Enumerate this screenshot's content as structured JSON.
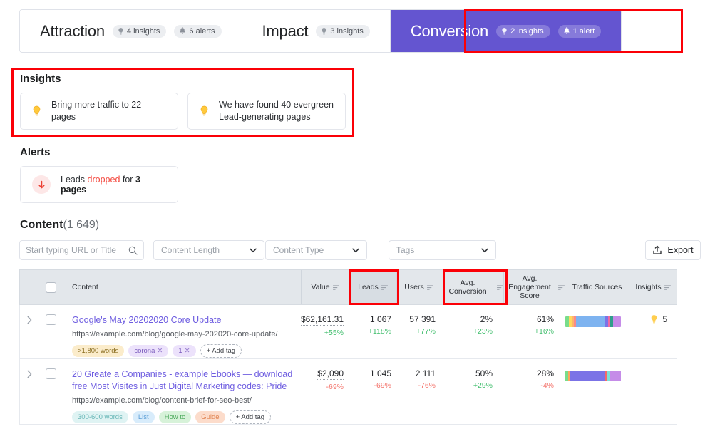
{
  "tabs": [
    {
      "label": "Attraction",
      "badges": [
        {
          "icon": "bulb-icon",
          "text": "4 insights"
        },
        {
          "icon": "bell-icon",
          "text": "6 alerts"
        }
      ],
      "active": false
    },
    {
      "label": "Impact",
      "badges": [
        {
          "icon": "bulb-icon",
          "text": "3 insights"
        }
      ],
      "active": false
    },
    {
      "label": "Conversion",
      "badges": [
        {
          "icon": "bulb-icon",
          "text": "2 insights"
        },
        {
          "icon": "bell-icon",
          "text": "1 alert"
        }
      ],
      "active": true
    }
  ],
  "insights": {
    "title": "Insights",
    "cards": [
      {
        "icon": "bulb-icon",
        "text": "Bring more traffic to 22 pages"
      },
      {
        "icon": "bulb-icon",
        "text": "We have found 40 evergreen Lead-generating pages"
      }
    ]
  },
  "alerts": {
    "title": "Alerts",
    "cards": [
      {
        "icon": "arrow-down-icon",
        "prefix": "Leads ",
        "highlight": "dropped",
        "middle": " for ",
        "strong": "3 pages"
      }
    ]
  },
  "content": {
    "title": "Content",
    "count": "(1 649)"
  },
  "filters": {
    "search_placeholder": "Start typing URL or Title",
    "search_value": "",
    "content_length": "Content Length",
    "content_type": "Content Type",
    "tags": "Tags",
    "export_label": "Export"
  },
  "table": {
    "columns": [
      {
        "label": "Content",
        "sortable": false
      },
      {
        "label": "Value",
        "sortable": true
      },
      {
        "label": "Leads",
        "sortable": true,
        "active": true
      },
      {
        "label": "Users",
        "sortable": true
      },
      {
        "label": "Avg. Conversion",
        "sortable": true
      },
      {
        "label": "Avg. Engagement Score",
        "sortable": true
      },
      {
        "label": "Traffic Sources",
        "sortable": false
      },
      {
        "label": "Insights",
        "sortable": true
      }
    ],
    "rows": [
      {
        "title": "Google's May 20202020 Core Update",
        "url": "https://example.com/blog/google-may-202020-core-update/",
        "tags": [
          {
            "label": ">1,800 words",
            "bg": "#fbeccb",
            "fg": "#8a6d1f",
            "removable": false
          },
          {
            "label": "corona",
            "bg": "#ece2fb",
            "fg": "#7a5bbd",
            "removable": true
          },
          {
            "label": "1",
            "bg": "#ece2fb",
            "fg": "#7a5bbd",
            "removable": true
          }
        ],
        "add_tag_label": "+ Add tag",
        "value": "$62,161.31",
        "value_delta": "+55%",
        "value_dir": "up",
        "leads": "1 067",
        "leads_delta": "+118%",
        "leads_dir": "up",
        "users": "57 391",
        "users_delta": "+77%",
        "users_dir": "up",
        "conversion": "2%",
        "conversion_delta": "+23%",
        "conversion_dir": "up",
        "engagement": "61%",
        "engagement_delta": "+16%",
        "engagement_dir": "up",
        "traffic_sources": [
          {
            "color": "#79dd8a",
            "pct": 6
          },
          {
            "color": "#ffd95e",
            "pct": 5
          },
          {
            "color": "#ffb36b",
            "pct": 5
          },
          {
            "color": "#f98a8a",
            "pct": 3
          },
          {
            "color": "#7eb3f0",
            "pct": 52
          },
          {
            "color": "#7b73e6",
            "pct": 6
          },
          {
            "color": "#f06aa0",
            "pct": 4
          },
          {
            "color": "#2f9e8a",
            "pct": 5
          },
          {
            "color": "#c58ce8",
            "pct": 14
          }
        ],
        "insights_icon": "bulb-icon",
        "insights_count": "5"
      },
      {
        "title": "20 Greate a Companies - example Ebooks — download free Most Visites in Just Digital Marketing codes: Pride",
        "url": "https://example.com/blog/content-brief-for-seo-best/",
        "tags": [
          {
            "label": "300-600 words",
            "bg": "#dff3f3",
            "fg": "#68b7b7",
            "removable": false
          },
          {
            "label": "List",
            "bg": "#d8ecfb",
            "fg": "#5b9ed6",
            "removable": false
          },
          {
            "label": "How to",
            "bg": "#d7f2d9",
            "fg": "#4aa85a",
            "removable": false
          },
          {
            "label": "Guide",
            "bg": "#fcdccb",
            "fg": "#e0824f",
            "removable": false
          }
        ],
        "add_tag_label": "+ Add tag",
        "value": "$2,090",
        "value_delta": "-69%",
        "value_dir": "down",
        "leads": "1 045",
        "leads_delta": "-69%",
        "leads_dir": "down",
        "users": "2 111",
        "users_delta": "-76%",
        "users_dir": "down",
        "conversion": "50%",
        "conversion_delta": "+29%",
        "conversion_dir": "up",
        "engagement": "28%",
        "engagement_delta": "-4%",
        "engagement_dir": "down",
        "traffic_sources": [
          {
            "color": "#79dd8a",
            "pct": 5
          },
          {
            "color": "#ffa45e",
            "pct": 4
          },
          {
            "color": "#7b73e6",
            "pct": 63
          },
          {
            "color": "#f4686a",
            "pct": 3
          },
          {
            "color": "#7ce0d6",
            "pct": 4
          },
          {
            "color": "#c58ce8",
            "pct": 21
          }
        ],
        "insights_icon": "",
        "insights_count": ""
      }
    ]
  },
  "colors": {
    "accent_purple": "#6455d0",
    "link_purple": "#6d5ce0",
    "positive_green": "#3ebd6b",
    "negative_red": "#f4746c",
    "alert_red": "#f4483e",
    "highlight_box": "#fb0007",
    "table_header_bg": "#e3e7eb"
  }
}
